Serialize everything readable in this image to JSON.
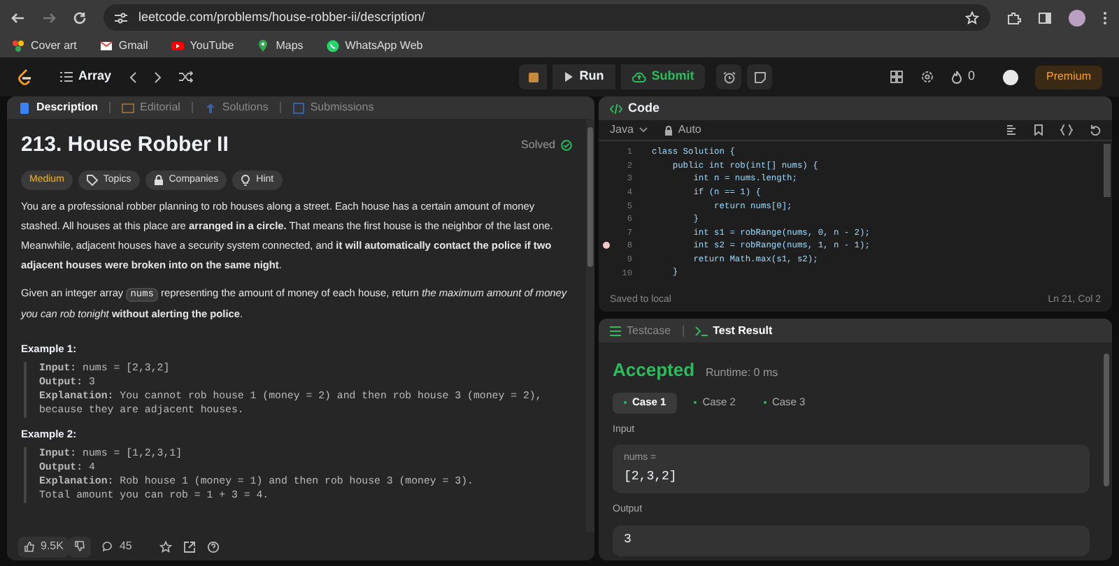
{
  "browser": {
    "url": "leetcode.com/problems/house-robber-ii/description/",
    "bookmarks": [
      {
        "label": "Cover art",
        "kind": "colors"
      },
      {
        "label": "Gmail",
        "kind": "mail"
      },
      {
        "label": "YouTube",
        "kind": "video"
      },
      {
        "label": "Maps",
        "kind": "pin"
      },
      {
        "label": "WhatsApp Web",
        "kind": "chat"
      }
    ]
  },
  "nav": {
    "problem_list": "Array",
    "run": "Run",
    "submit": "Submit",
    "streak": "0",
    "premium": "Premium"
  },
  "description_panel": {
    "tabs": [
      {
        "label": "Description",
        "selected": true
      },
      {
        "label": "Editorial",
        "selected": false
      },
      {
        "label": "Solutions",
        "selected": false
      },
      {
        "label": "Submissions",
        "selected": false
      }
    ],
    "title": "213. House Robber II",
    "status": "Solved",
    "tags": [
      {
        "label": "Medium",
        "kind": "difficulty"
      },
      {
        "label": "Topics",
        "kind": "tag"
      },
      {
        "label": "Companies",
        "kind": "lock"
      },
      {
        "label": "Hint",
        "kind": "bulb"
      }
    ],
    "paragraphs": [
      [
        {
          "kind": "text",
          "text": "You are a professional robber planning to rob houses along a street. Each house has a certain amount of money stashed. All houses at this place are **arranged in a circle.** That means the first house is the neighbor of the last one. Meanwhile, adjacent houses have a security system connected, and **it will automatically contact the police if two adjacent houses were broken into on the same night**."
        }
      ],
      [
        {
          "kind": "text",
          "text": "Given an integer array "
        },
        {
          "kind": "code",
          "text": "nums"
        },
        {
          "kind": "text",
          "text": " representing the amount of money of each house, return *the maximum amount of money you can rob tonight* **without alerting the police**."
        }
      ]
    ],
    "examples": [
      {
        "title": "Example 1:",
        "lines": [
          "**Input:** nums = [2,3,2]",
          "**Output:** 3",
          "**Explanation:** You cannot rob house 1 (money = 2) and then rob house 3 (money = 2),",
          "because they are adjacent houses."
        ]
      },
      {
        "title": "Example 2:",
        "lines": [
          "**Input:** nums = [1,2,3,1]",
          "**Output:** 4",
          "**Explanation:** Rob house 1 (money = 1) and then rob house 3 (money = 3).",
          "Total amount you can rob = 1 + 3 = 4."
        ]
      }
    ],
    "likes": "9.5K",
    "comments": "45"
  },
  "code_panel": {
    "title": "Code",
    "language": "Java",
    "mode": "Auto",
    "lines": [
      {
        "number": "1",
        "text": "class Solution {",
        "breakpoint": false
      },
      {
        "number": "2",
        "text": "    public int rob(int[] nums) {",
        "breakpoint": false
      },
      {
        "number": "3",
        "text": "        int n = nums.length;",
        "breakpoint": false
      },
      {
        "number": "4",
        "text": "        if (n == 1) {",
        "breakpoint": false
      },
      {
        "number": "5",
        "text": "            return nums[0];",
        "breakpoint": false
      },
      {
        "number": "6",
        "text": "        }",
        "breakpoint": false
      },
      {
        "number": "7",
        "text": "        int s1 = robRange(nums, 0, n - 2);",
        "breakpoint": false
      },
      {
        "number": "8",
        "text": "        int s2 = robRange(nums, 1, n - 1);",
        "breakpoint": true
      },
      {
        "number": "9",
        "text": "        return Math.max(s1, s2);",
        "breakpoint": false
      },
      {
        "number": "10",
        "text": "    }",
        "breakpoint": false
      }
    ],
    "status": "Saved to local",
    "cursor": "Ln 21, Col 2"
  },
  "result_panel": {
    "tabs": [
      {
        "label": "Testcase",
        "selected": false
      },
      {
        "label": "Test Result",
        "selected": true
      }
    ],
    "verdict": "Accepted",
    "runtime": "Runtime: 0 ms",
    "cases": [
      {
        "label": "Case 1",
        "selected": true
      },
      {
        "label": "Case 2",
        "selected": false
      },
      {
        "label": "Case 3",
        "selected": false
      }
    ],
    "input_label": "Input",
    "input_name": "nums =",
    "input_value": "[2,3,2]",
    "output_label": "Output",
    "output_value": "3"
  }
}
